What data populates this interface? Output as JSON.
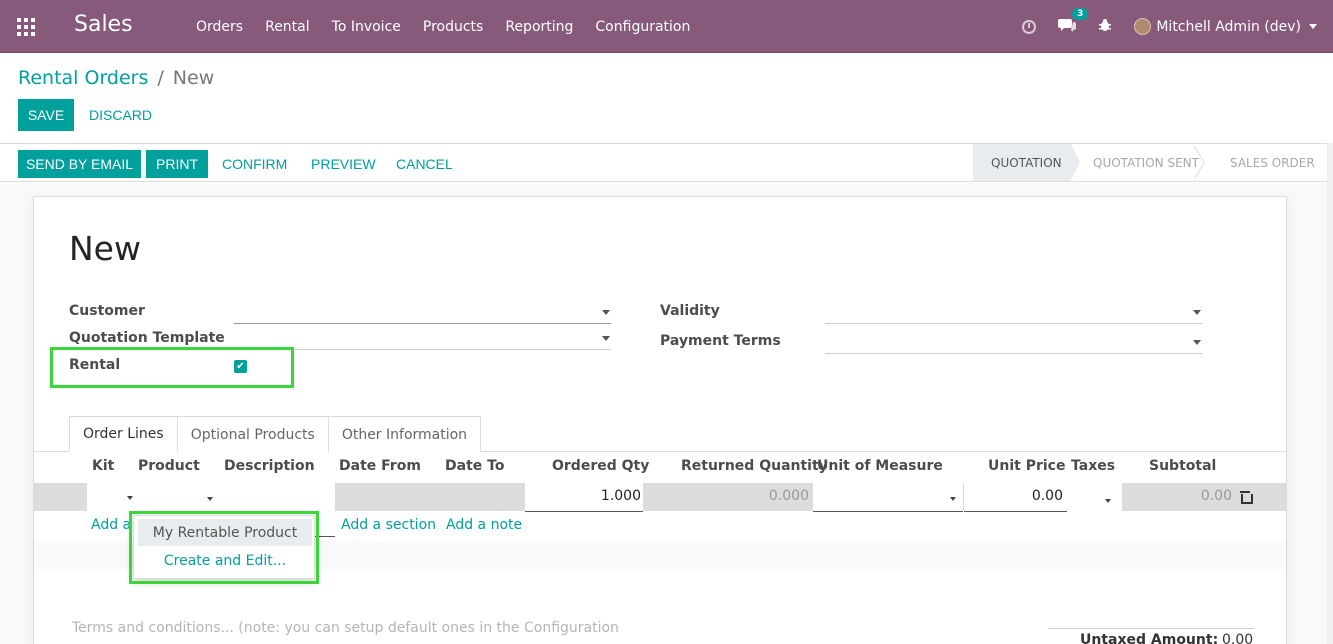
{
  "navbar": {
    "app_name": "Sales",
    "menu": [
      "Orders",
      "Rental",
      "To Invoice",
      "Products",
      "Reporting",
      "Configuration"
    ],
    "messages_count": "3",
    "user": "Mitchell Admin (dev)"
  },
  "breadcrumb": {
    "parent": "Rental Orders",
    "separator": "/",
    "current": "New"
  },
  "actions": {
    "save": "SAVE",
    "discard": "DISCARD"
  },
  "statusbar": {
    "buttons": [
      "SEND BY EMAIL",
      "PRINT",
      "CONFIRM",
      "PREVIEW",
      "CANCEL"
    ],
    "stages": [
      "QUOTATION",
      "QUOTATION SENT",
      "SALES ORDER"
    ],
    "active_stage": "QUOTATION"
  },
  "form": {
    "title": "New",
    "customer_label": "Customer",
    "quotation_template_label": "Quotation Template",
    "rental_label": "Rental",
    "rental_checked": true,
    "validity_label": "Validity",
    "payment_terms_label": "Payment Terms"
  },
  "tabs": [
    "Order Lines",
    "Optional Products",
    "Other Information"
  ],
  "order_lines": {
    "columns": [
      "Kit",
      "Product",
      "Description",
      "Date From",
      "Date To",
      "Ordered Qty",
      "Returned Quantity",
      "Unit of Measure",
      "Unit Price",
      "Taxes",
      "Subtotal"
    ],
    "row": {
      "ordered_qty": "1.000",
      "returned_qty": "0.000",
      "unit_price": "0.00",
      "subtotal": "0.00"
    },
    "add_product": "Add a product",
    "add_product_visible": "Add a",
    "add_section": "Add a section",
    "add_note": "Add a note"
  },
  "product_dropdown": {
    "items": [
      "My Rentable Product",
      "Create and Edit..."
    ]
  },
  "terms_placeholder": "Terms and conditions... (note: you can setup default ones in the Configuration",
  "totals": {
    "untaxed_label": "Untaxed Amount:",
    "untaxed_value": "0.00"
  },
  "colors": {
    "navbar": "#875a7b",
    "accent": "#00a09d",
    "highlight_box": "#3ad63a"
  }
}
